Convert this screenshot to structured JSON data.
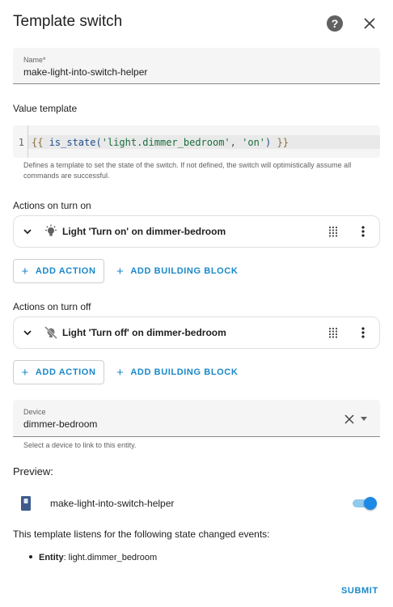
{
  "dialog": {
    "title": "Template switch",
    "help_icon": "help-circle-icon",
    "close_icon": "close-icon"
  },
  "name_field": {
    "label": "Name*",
    "value": "make-light-into-switch-helper"
  },
  "value_template": {
    "label": "Value template",
    "line_number": "1",
    "code_open": "{{ ",
    "code_fn": "is_state(",
    "code_arg1": "'light.dimmer_bedroom'",
    "code_sep": ", ",
    "code_arg2": "'on'",
    "code_close_paren": ")",
    "code_close": " }}",
    "helper": "Defines a template to set the state of the switch. If not defined, the switch will optimistically assume all commands are successful."
  },
  "actions_on": {
    "label": "Actions on turn on",
    "item_label": "Light 'Turn on' on dimmer-bedroom",
    "item_icon": "lightbulb-on-icon",
    "add_action": "ADD ACTION",
    "add_block": "ADD BUILDING BLOCK"
  },
  "actions_off": {
    "label": "Actions on turn off",
    "item_label": "Light 'Turn off' on dimmer-bedroom",
    "item_icon": "lightbulb-off-icon",
    "add_action": "ADD ACTION",
    "add_block": "ADD BUILDING BLOCK"
  },
  "device": {
    "label": "Device",
    "value": "dimmer-bedroom",
    "helper": "Select a device to link to this entity."
  },
  "preview": {
    "title": "Preview:",
    "entity_name": "make-light-into-switch-helper",
    "toggle_on": true,
    "listen_text": "This template listens for the following state changed events:",
    "entity_label": "Entity",
    "entity_value": ": light.dimmer_bedroom"
  },
  "footer": {
    "submit": "SUBMIT"
  },
  "colors": {
    "accent": "#1a88c9",
    "toggle": "#1e88e5"
  }
}
